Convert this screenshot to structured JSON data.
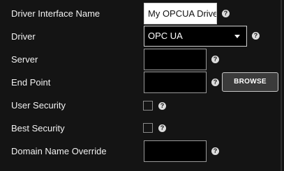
{
  "form": {
    "driver_interface_name": {
      "label": "Driver Interface Name",
      "value": "My OPCUA Driver"
    },
    "driver": {
      "label": "Driver",
      "selected": "OPC UA"
    },
    "server": {
      "label": "Server",
      "value": ""
    },
    "end_point": {
      "label": "End Point",
      "value": "",
      "browse_label": "BROWSE"
    },
    "user_security": {
      "label": "User Security",
      "checked": false
    },
    "best_security": {
      "label": "Best Security",
      "checked": false
    },
    "domain_name_override": {
      "label": "Domain Name Override",
      "value": ""
    }
  },
  "help_glyph": "?",
  "icons": [
    "help-icon",
    "chevron-down-icon"
  ]
}
